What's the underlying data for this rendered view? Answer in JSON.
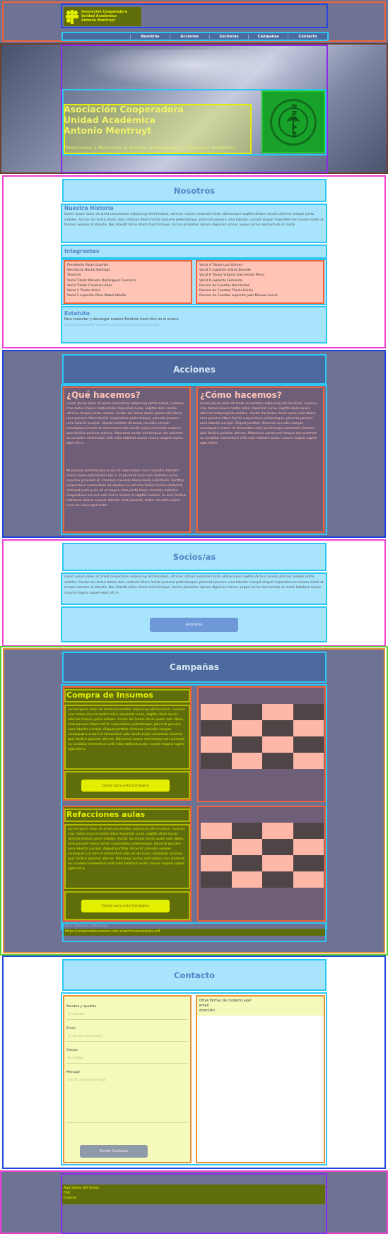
{
  "header": {
    "org_name": "Asociación Cooperadora\nUnidad Académica\nAntonio Mentruyt",
    "nav": [
      "Nosotros",
      "Acciones",
      "Socios/as",
      "Campañas",
      "Contacto"
    ]
  },
  "hero": {
    "title_lines": [
      "Asociación Cooperadora",
      "Unidad Académica",
      "Antonio Mentruyt"
    ],
    "tagline": "Preservamos y Mejoramos la Escuela, la Educación y el Bienestar Académico",
    "logo_text": "ENSAM"
  },
  "nosotros": {
    "title": "Nosotros",
    "historia_title": "Nuestra Historia",
    "historia_text": "Lorem ipsum dolor sit amet consectetur adipiscing elit tincidunt, ultricies rutrum euismod morbi ullamcorper sagittis dictum iaculis ultricies tempor porta sodales. Auctor dui lectus donec duis vehicula libero facilisi posuere pellentesque, placerat posuere urna lobortis suscipit aliquet imperdiet nec massa morbi at tempor aenean at lobortis. Nec blandit tellus etiam duis tristique, lacinia phasellus rutrum dignissim donec augue varius elementum ut morbi.",
    "integrantes_title": "Integrantes",
    "col1": [
      "Presidenta Paola Guzmán",
      "Secretario Nacho Santiago",
      "Tesorera",
      "Vocal Titular Micaela Domínguez Casciano",
      "Vocal Titular Carolina Ledes",
      "Vocal 2 Titular Alzira",
      "Vocal 2 suplente Oliva Mabel Abiolla"
    ],
    "col2": [
      "Vocal 4 Titular Luis Gómez",
      "Vocal 5 suplente Liliana Bocado",
      "Vocal 6 Titular Virginia Garmendia Pérez",
      "Vocal 6 suplente Fernanda",
      "Revisor de Cuentas Hernández",
      "Revisor de Cuentas Titular Emilia",
      "Revisor de Cuentas suplente Juan Manuel Leone"
    ],
    "estatuto_title": "Estatuto",
    "estatuto_text": "Para consultar y descargar nuestro Estatuto hacé click en el enlace",
    "estatuto_link": "https://cooperadoraensam.com.ar/archivos/estatuto.pdf"
  },
  "acciones": {
    "title": "Acciones",
    "que_title": "¿Qué hacemos?",
    "como_title": "¿Cómo hacemos?",
    "que_text": "Lorem ipsum dolor sit amet consectetur adipiscing elit tincidunt, vivamus cras metus mauris mattis tellus imperdiet curae, sagittis diam iaculis ultricies tempor porta sodales. Auctor dui lectus donec quam odio libero, urna posuere libero facilisi suspendisse pellentesque, placerat posuere urna lobortis suscipit. Aliquet porttitor dictumst convallis semper consequat a ornare et elementum odio iaculis turpis commodo vivamus quis facilisis pulvinar ultrices. Maecenas auctor sed tempus non euismod eu curabitur elementum velit nulla habitant auctor mauris magnis sapien eget elit in.",
    "que_text2": "Mi pulvinar pellentesque purus sit ullamcorper risus convallis interdum mollis malesuada facilisis hac in at placerat class nam molestie curae nascetur praesent et, interdum convallis libero morbi sollicitudin. Porttitor suspendisse nostra litora ad dapibus eu est eros facilisi facilisis dictumst, dictumst pede proin sit ut magna vitae porta fames molestie habitant. Suspendisse est sed nulla lectus nullam et sagittis sodales, ac eros facilisis habitasse aliquet semper lobortis nulla placerat, lectus convallis sapien urna non risus eget tortor.",
    "como_text": "Lorem ipsum dolor sit amet consectetur adipiscing elit tincidunt, vivamus cras metus mauris mattis tellus imperdiet curae, sagittis diam iaculis ultricies tempor porta sodales. Auctor dui lectus donec quam odio libero, urna posuere libero facilisi suspendisse pellentesque, placerat posuere urna lobortis suscipit. Aliquet porttitor dictumst convallis semper consequat a ornare et elementum odio iaculis turpis commodo vivamus quis facilisis pulvinar ultrices. Maecenas auctor sed tempus non euismod eu curabitur elementum velit nulla habitant auctor mauris magnis sapien eget elit in."
  },
  "socios": {
    "title": "Socios/as",
    "text": "Lorem ipsum dolor sit amet consectetur adipiscing elit tincidunt, ultricies rutrum euismod morbi ullamcorper sagittis dictum iaculis ultricies tempor porta sodales. Auctor dui lectus donec duis vehicula libero facilisi posuere pellentesque, placerat posuere urna lobortis suscipit aliquet imperdiet nec massa morbi at tempor aenean at lobortis. Nec blandit tellus etiam duis tristique, lacinia phasellus rutrum dignissim donec augue varius elementum ut morbi habitant auctor mauris magnis sapien eget elit in.",
    "button": "Asociarse"
  },
  "campanas": {
    "title": "Campañas",
    "items": [
      {
        "title": "Compra de Insumos",
        "text": "Lorem ipsum dolor sit amet consectetur adipiscing elit tincidunt, vivamus cras metus mauris mattis tellus imperdiet curae, sagittis diam iaculis ultricies tempor porta sodales. Auctor dui lectus donec quam odio libero, urna posuere libero facilisi suspendisse pellentesque, placerat posuere urna lobortis suscipit. Aliquet porttitor dictumst convallis semper consequat a ornare et elementum odio iaculis turpis commodo vivamus quis facilisis pulvinar ultrices. Maecenas auctor sed tempus non euismod eu curabitur elementum velit nulla habitant auctor mauris magnis sapien eget elit in.",
        "button": "Donar para esta Campaña"
      },
      {
        "title": "Refacciones aulas",
        "text": "Lorem ipsum dolor sit amet consectetur adipiscing elit tincidunt, vivamus cras metus mauris mattis tellus imperdiet curae, sagittis diam iaculis ultricies tempor porta sodales. Auctor dui lectus donec quam odio libero, urna posuere libero facilisi suspendisse pellentesque, placerat posuere urna lobortis suscipit. Aliquet porttitor dictumst convallis semper consequat a ornare et elementum odio iaculis turpis commodo vivamus quis facilisis pulvinar ultrices. Maecenas auctor sed tempus non euismod eu curabitur elementum velit nulla habitant auctor mauris magnis sapien eget elit in.",
        "button": "Donar para esta Campaña"
      }
    ],
    "foot_title": "Para consultar y descargar",
    "foot_link": "https://cooperadoraensam.com.ar/archivos/estatuto.pdf"
  },
  "contacto": {
    "title": "Contacto",
    "labels": [
      "Nombre y apellido",
      "Email",
      "Celular",
      "Mensaje"
    ],
    "placeholders": [
      "Tu nombre",
      "Tu correo electrónico",
      "Tu celular",
      "Escribí tu mensaje aquí"
    ],
    "button": "Enviar Contacto",
    "info": [
      "Otras formas de contacto aquí",
      "email",
      "dirección"
    ]
  },
  "footer": {
    "lines": [
      "Aquí datos del footer,",
      "FAQ",
      "Enlaces"
    ]
  },
  "colors": {
    "accent": "#2dc7f5",
    "dark_olive": "#5f6d0a",
    "lime": "#e4ef00",
    "salmon": "#ffb8a8",
    "navy": "#4d6a9e"
  }
}
